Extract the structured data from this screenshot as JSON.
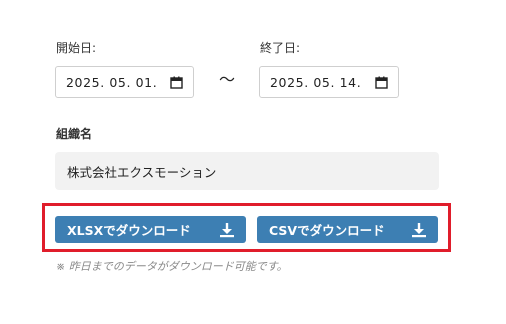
{
  "start_date": {
    "label": "開始日:",
    "value": "2025. 05. 01."
  },
  "range_separator": "〜",
  "end_date": {
    "label": "終了日:",
    "value": "2025. 05. 14."
  },
  "organization": {
    "label": "組織名",
    "value": "株式会社エクスモーション"
  },
  "buttons": {
    "xlsx_label": "XLSXでダウンロード",
    "csv_label": "CSVでダウンロード"
  },
  "note": "※ 昨日までのデータがダウンロード可能です。",
  "colors": {
    "button_bg": "#3d7fb3",
    "highlight_border": "#e01d2b",
    "field_bg": "#f2f2f2"
  },
  "icons": {
    "calendar": "calendar-icon",
    "download": "download-icon"
  }
}
